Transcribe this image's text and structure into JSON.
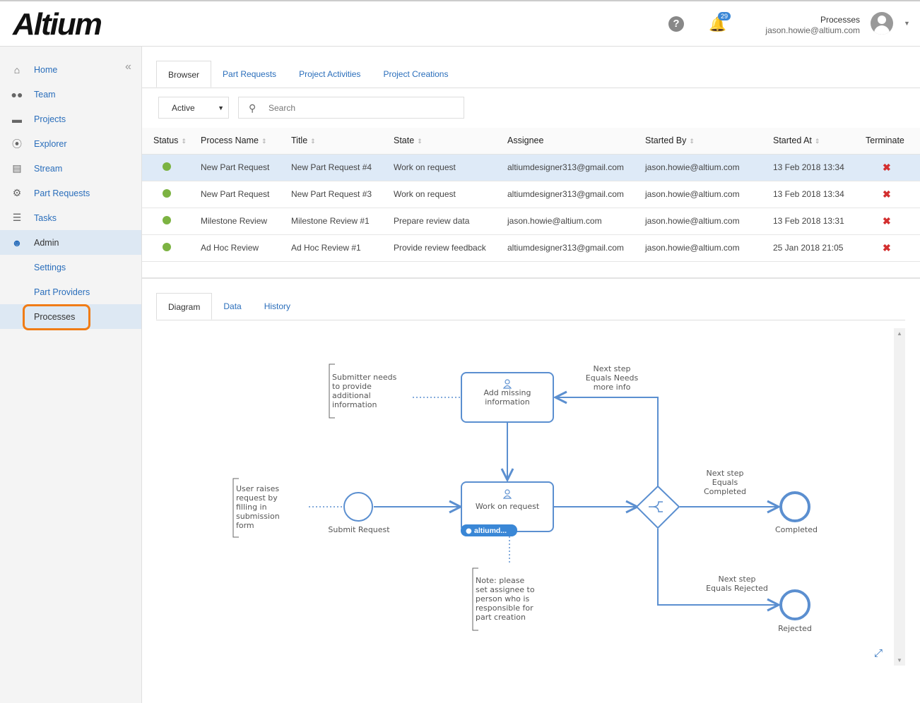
{
  "header": {
    "logo": "Altium",
    "notifications": "29",
    "page": "Processes",
    "user_email": "jason.howie@altium.com"
  },
  "sidebar": {
    "items": [
      {
        "label": "Home",
        "icon": "home-icon"
      },
      {
        "label": "Team",
        "icon": "team-icon"
      },
      {
        "label": "Projects",
        "icon": "folder-icon"
      },
      {
        "label": "Explorer",
        "icon": "compass-icon"
      },
      {
        "label": "Stream",
        "icon": "stream-icon"
      },
      {
        "label": "Part Requests",
        "icon": "chip-icon"
      },
      {
        "label": "Tasks",
        "icon": "tasks-icon"
      },
      {
        "label": "Admin",
        "icon": "user-circle-icon"
      }
    ],
    "sub_items": [
      "Settings",
      "Part Providers",
      "Processes"
    ]
  },
  "tabs": [
    "Browser",
    "Part Requests",
    "Project Activities",
    "Project Creations"
  ],
  "filter": {
    "selected": "Active",
    "search_placeholder": "Search"
  },
  "table": {
    "columns": [
      "Status",
      "Process Name",
      "Title",
      "State",
      "Assignee",
      "Started By",
      "Started At",
      "Terminate"
    ],
    "rows": [
      {
        "process": "New Part Request",
        "title": "New Part Request #4",
        "state": "Work on request",
        "assignee": "altiumdesigner313@gmail.com",
        "started_by": "jason.howie@altium.com",
        "started_at": "13 Feb 2018 13:34"
      },
      {
        "process": "New Part Request",
        "title": "New Part Request #3",
        "state": "Work on request",
        "assignee": "altiumdesigner313@gmail.com",
        "started_by": "jason.howie@altium.com",
        "started_at": "13 Feb 2018 13:34"
      },
      {
        "process": "Milestone Review",
        "title": "Milestone Review #1",
        "state": "Prepare review data",
        "assignee": "jason.howie@altium.com",
        "started_by": "jason.howie@altium.com",
        "started_at": "13 Feb 2018 13:31"
      },
      {
        "process": "Ad Hoc Review",
        "title": "Ad Hoc Review #1",
        "state": "Provide review feedback",
        "assignee": "altiumdesigner313@gmail.com",
        "started_by": "jason.howie@altium.com",
        "started_at": "25 Jan 2018 21:05"
      }
    ]
  },
  "detail_tabs": [
    "Diagram",
    "Data",
    "History"
  ],
  "diagram": {
    "note1": [
      "Submitter needs",
      "to provide",
      "additional",
      "information"
    ],
    "task1": [
      "Add missing",
      "information"
    ],
    "cond1": [
      "Next step",
      "Equals Needs",
      "more info"
    ],
    "note2": [
      "User raises",
      "request by",
      "filling in",
      "submission",
      "form"
    ],
    "start": "Submit Request",
    "task2": "Work on request",
    "assignee": "altiumd...",
    "cond2": [
      "Next step",
      "Equals",
      "Completed"
    ],
    "end1": "Completed",
    "note3": [
      "Note: please",
      "set assignee to",
      "person who is",
      "responsible for",
      "part creation"
    ],
    "cond3": [
      "Next step",
      "Equals Rejected"
    ],
    "end2": "Rejected"
  }
}
